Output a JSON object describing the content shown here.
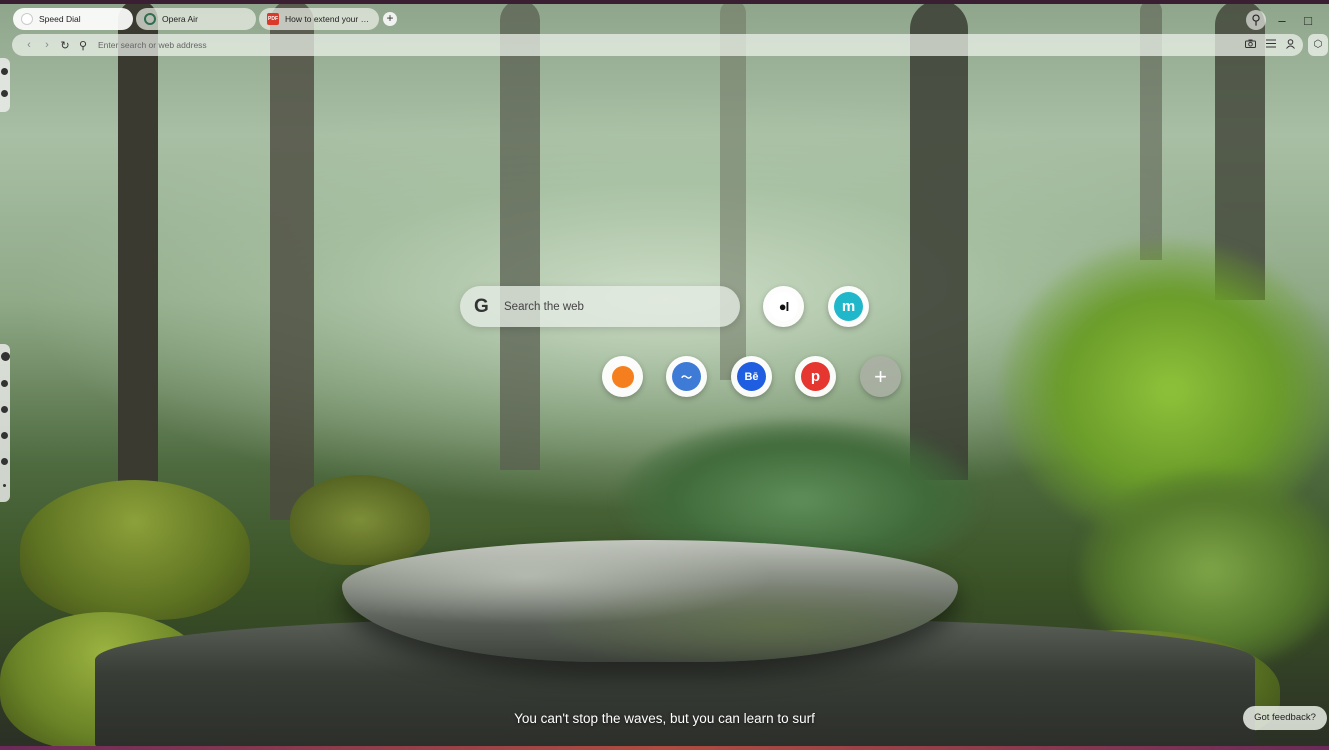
{
  "tabs": [
    {
      "label": "Speed Dial",
      "active": true,
      "favicon": "opera-icon"
    },
    {
      "label": "Opera Air",
      "active": false,
      "favicon": "opera-air-icon"
    },
    {
      "label": "How to extend your gar",
      "active": false,
      "favicon": "pdf-icon",
      "favicon_text": "PDF"
    }
  ],
  "toolbar": {
    "new_tab_symbol": "+",
    "search_symbol": "⚲",
    "minimize_symbol": "–",
    "maximize_symbol": "□"
  },
  "address_bar": {
    "placeholder": "Enter search or web address",
    "back_symbol": "‹",
    "forward_symbol": "›",
    "reload_symbol": "↻",
    "search_symbol": "⚲",
    "right_icons": [
      "camera-icon",
      "menu-icon",
      "profile-icon"
    ],
    "extensions_symbol": "⬡"
  },
  "search": {
    "logo": "G",
    "placeholder": "Search the web"
  },
  "speed_dial": [
    {
      "name": "medium",
      "symbol": "●I",
      "color": "#111111"
    },
    {
      "name": "m-site",
      "symbol": "m",
      "color": "#1fb7c9"
    },
    {
      "name": "orange-site",
      "symbol": "",
      "color": "#f57f1e"
    },
    {
      "name": "wave-site",
      "symbol": "〜",
      "color": "#3e7bd6"
    },
    {
      "name": "behance",
      "symbol": "Bē",
      "color": "#1f5ee0"
    },
    {
      "name": "p-site",
      "symbol": "p",
      "color": "#e5362f"
    },
    {
      "name": "add",
      "symbol": "+",
      "color": "#a8aca4"
    }
  ],
  "quote": "You can't stop the waves, but you can learn to surf",
  "feedback": "Got feedback?"
}
